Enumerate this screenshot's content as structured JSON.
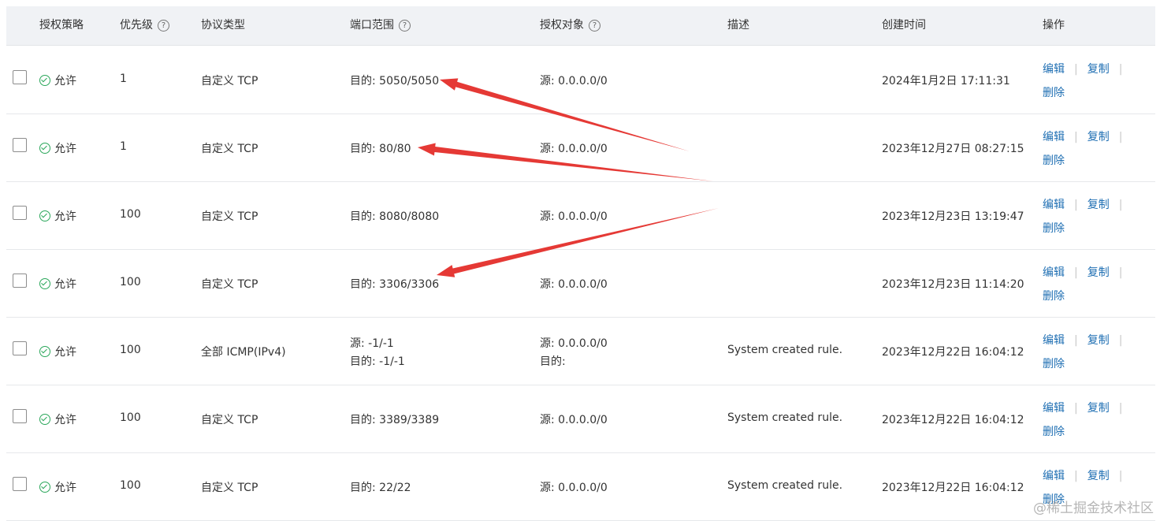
{
  "header": {
    "policy": "授权策略",
    "priority": "优先级",
    "protocol": "协议类型",
    "port_range": "端口范围",
    "target": "授权对象",
    "description": "描述",
    "created": "创建时间",
    "actions": "操作",
    "help_glyph": "?"
  },
  "actions": {
    "edit": "编辑",
    "copy": "复制",
    "delete": "删除",
    "separator": "|"
  },
  "rows": [
    {
      "policy": "允许",
      "priority": "1",
      "protocol": "自定义 TCP",
      "port_line1": "目的: 5050/5050",
      "port_line2": "",
      "target_line1": "源: 0.0.0.0/0",
      "target_line2": "",
      "description": "",
      "created": "2024年1月2日 17:11:31"
    },
    {
      "policy": "允许",
      "priority": "1",
      "protocol": "自定义 TCP",
      "port_line1": "目的: 80/80",
      "port_line2": "",
      "target_line1": "源: 0.0.0.0/0",
      "target_line2": "",
      "description": "",
      "created": "2023年12月27日 08:27:15"
    },
    {
      "policy": "允许",
      "priority": "100",
      "protocol": "自定义 TCP",
      "port_line1": "目的: 8080/8080",
      "port_line2": "",
      "target_line1": "源: 0.0.0.0/0",
      "target_line2": "",
      "description": "",
      "created": "2023年12月23日 13:19:47"
    },
    {
      "policy": "允许",
      "priority": "100",
      "protocol": "自定义 TCP",
      "port_line1": "目的: 3306/3306",
      "port_line2": "",
      "target_line1": "源: 0.0.0.0/0",
      "target_line2": "",
      "description": "",
      "created": "2023年12月23日 11:14:20"
    },
    {
      "policy": "允许",
      "priority": "100",
      "protocol": "全部 ICMP(IPv4)",
      "port_line1": "源: -1/-1",
      "port_line2": "目的: -1/-1",
      "target_line1": "源: 0.0.0.0/0",
      "target_line2": "目的:",
      "description": "System created rule.",
      "created": "2023年12月22日 16:04:12"
    },
    {
      "policy": "允许",
      "priority": "100",
      "protocol": "自定义 TCP",
      "port_line1": "目的: 3389/3389",
      "port_line2": "",
      "target_line1": "源: 0.0.0.0/0",
      "target_line2": "",
      "description": "System created rule.",
      "created": "2023年12月22日 16:04:12"
    },
    {
      "policy": "允许",
      "priority": "100",
      "protocol": "自定义 TCP",
      "port_line1": "目的: 22/22",
      "port_line2": "",
      "target_line1": "源: 0.0.0.0/0",
      "target_line2": "",
      "description": "System created rule.",
      "created": "2023年12月22日 16:04:12"
    }
  ],
  "annotation_color": "#e53935",
  "watermark": "@稀土掘金技术社区"
}
